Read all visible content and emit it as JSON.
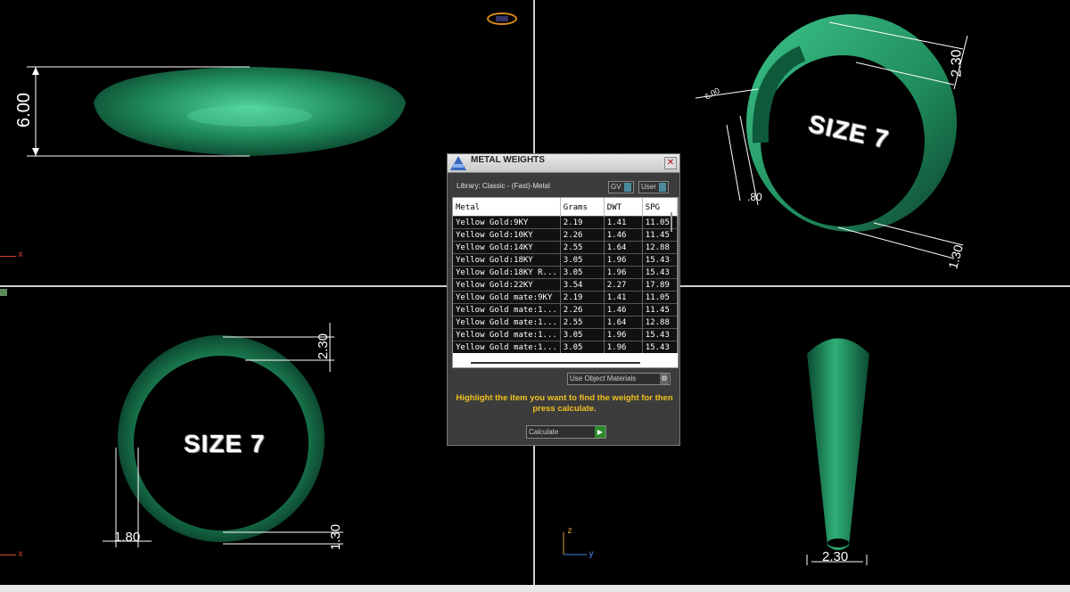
{
  "viewports": {
    "top_left": {
      "dimension": "6.00",
      "axis_x": "x"
    },
    "top_right": {
      "size_label": "SIZE 7",
      "dims": [
        "2.30",
        "6.00",
        ".80",
        "1.30"
      ]
    },
    "bottom_left": {
      "size_label": "SIZE 7",
      "dims": [
        "2.30",
        "1.80",
        "1.30"
      ],
      "axis_x": "x"
    },
    "bottom_right": {
      "dimension": "2.30",
      "axis_z": "z",
      "axis_y": "y"
    }
  },
  "dialog": {
    "title": "METAL WEIGHTS",
    "library": "Library: Classic - (Fast)-Metal",
    "gv_label": "GV",
    "user_label": "User",
    "columns": [
      "Metal",
      "Grams",
      "DWT",
      "SPG"
    ],
    "rows": [
      [
        "Yellow Gold:9KY",
        "2.19",
        "1.41",
        "11.05"
      ],
      [
        "Yellow Gold:10KY",
        "2.26",
        "1.46",
        "11.45"
      ],
      [
        "Yellow Gold:14KY",
        "2.55",
        "1.64",
        "12.88"
      ],
      [
        "Yellow Gold:18KY",
        "3.05",
        "1.96",
        "15.43"
      ],
      [
        "Yellow Gold:18KY R...",
        "3.05",
        "1.96",
        "15.43"
      ],
      [
        "Yellow Gold:22KY",
        "3.54",
        "2.27",
        "17.89"
      ],
      [
        "Yellow Gold mate:9KY",
        "2.19",
        "1.41",
        "11.05"
      ],
      [
        "Yellow Gold mate:1...",
        "2.26",
        "1.46",
        "11.45"
      ],
      [
        "Yellow Gold mate:1...",
        "2.55",
        "1.64",
        "12.88"
      ],
      [
        "Yellow Gold mate:1...",
        "3.05",
        "1.96",
        "15.43"
      ],
      [
        "Yellow Gold mate:1...",
        "3.05",
        "1.96",
        "15.43"
      ]
    ],
    "use_object_materials": "Use Object Materials",
    "instruction": "Highlight the item you want to find the weight for then press calculate.",
    "calculate_label": "Calculate"
  },
  "colors": {
    "ring_green": "#1f8a5c",
    "ring_dark": "#0c4a30",
    "instruction_yellow": "#f0c020"
  }
}
